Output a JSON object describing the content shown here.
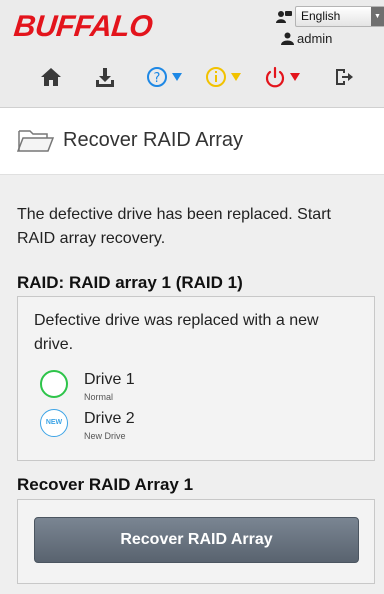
{
  "header": {
    "logo_text": "BUFFALO",
    "language": {
      "selected": "English"
    },
    "user": {
      "name": "admin"
    },
    "toolbar": {
      "items": [
        {
          "icon": "home-icon"
        },
        {
          "icon": "download-icon"
        },
        {
          "icon": "help-icon",
          "color": "#1e88e5"
        },
        {
          "icon": "info-icon",
          "color": "#f2c200"
        },
        {
          "icon": "power-icon",
          "color": "#e3141c"
        },
        {
          "icon": "logout-icon"
        }
      ]
    }
  },
  "page": {
    "icon": "folder-icon",
    "title": "Recover RAID Array"
  },
  "content": {
    "intro": "The defective drive has been replaced. Start RAID array recovery.",
    "raid_heading": "RAID: RAID array 1 (RAID 1)",
    "raid_message": "Defective drive was replaced with a new drive.",
    "drives": [
      {
        "name": "Drive 1",
        "status": "Normal",
        "icon": "status-ok-icon",
        "color": "#2ec44a"
      },
      {
        "name": "Drive 2",
        "status": "New Drive",
        "icon": "status-new-icon",
        "badge": "NEW",
        "color": "#3da4e6"
      }
    ],
    "recover_heading": "Recover RAID Array 1",
    "recover_button": "Recover RAID Array"
  },
  "colors": {
    "brand": "#e3141c",
    "button": "#636d79"
  }
}
